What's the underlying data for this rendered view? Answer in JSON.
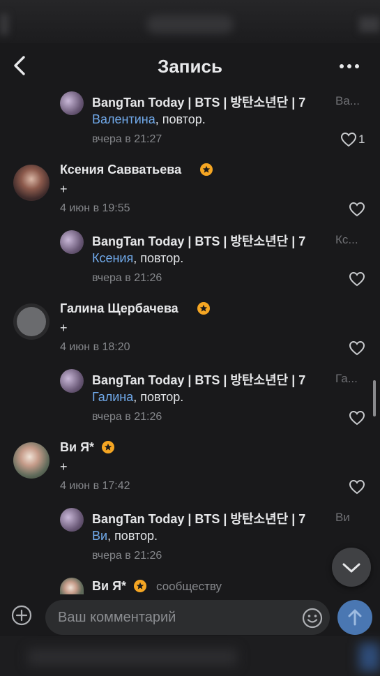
{
  "header": {
    "title": "Запись"
  },
  "icons": {
    "back": "chevron-left-icon",
    "more": "more-horizontal-icon",
    "like": "heart-outline-icon",
    "verified": "star-badge-icon"
  },
  "colors": {
    "accent": "#71aaeb",
    "badge": "#f5a623",
    "send": "#4a77b2",
    "background": "#19191b"
  },
  "comments": [
    {
      "author": "BangTan Today | BTS | 방탄소년단 | 7",
      "reply_to": "Ва...",
      "mention": "Валентина",
      "text": ", повтор.",
      "time": "вчера в 21:27",
      "likes": "1"
    },
    {
      "author": "Ксения Савватьева",
      "text": "+",
      "time": "4 июн в 19:55"
    },
    {
      "author": "BangTan Today | BTS | 방탄소년단 | 7",
      "reply_to": "Кс...",
      "mention": "Ксения",
      "text": ", повтор.",
      "time": "вчера в 21:26"
    },
    {
      "author": "Галина Щербачева",
      "text": "+",
      "time": "4 июн в 18:20"
    },
    {
      "author": "BangTan Today | BTS | 방탄소년단 | 7",
      "reply_to": "Га...",
      "mention": "Галина",
      "text": ", повтор.",
      "time": "вчера в 21:26"
    },
    {
      "author": "Ви Я*",
      "text": "+",
      "time": "4 июн в 17:42"
    },
    {
      "author": "BangTan Today | BTS | 방탄소년단 | 7",
      "reply_to": "Ви",
      "mention": "Ви",
      "text": ", повтор.",
      "time": "вчера в 21:26"
    },
    {
      "author": "Ви Я*",
      "reply_to": "сообществу"
    }
  ],
  "composer": {
    "placeholder": "Ваш комментарий"
  }
}
